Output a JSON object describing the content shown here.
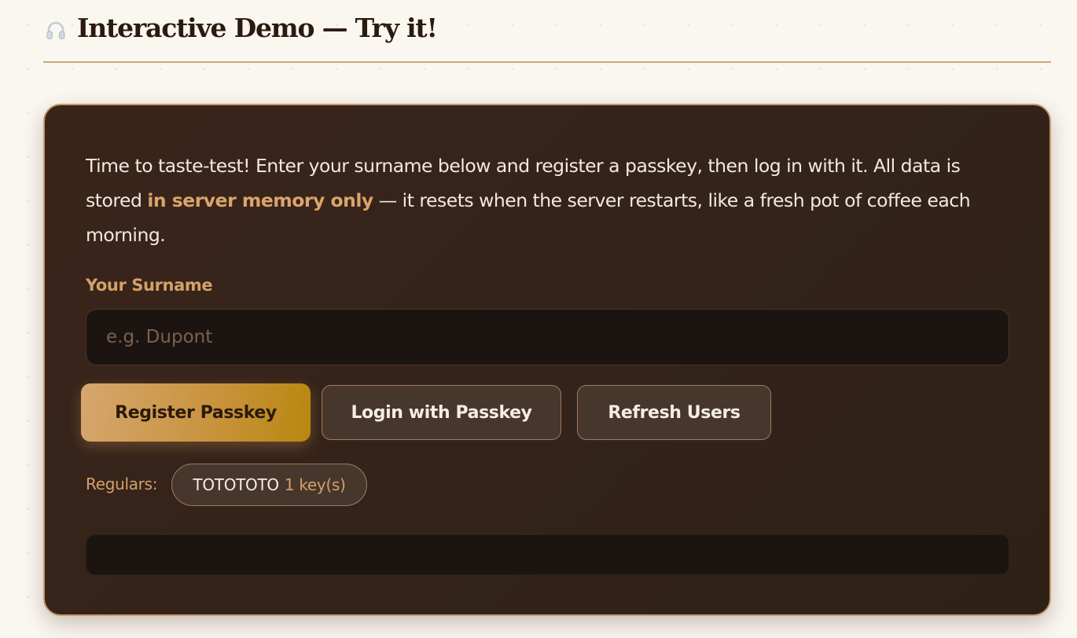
{
  "section": {
    "icon": "headphones-icon",
    "title": "Interactive Demo — Try it!"
  },
  "demo": {
    "intro_before": "Time to taste-test! Enter your surname below and register a passkey, then log in with it. All data is stored ",
    "intro_highlight": "in server memory only",
    "intro_after": " — it resets when the server restarts, like a fresh pot of coffee each morning.",
    "surname_label": "Your Surname",
    "surname_placeholder": "e.g. Dupont",
    "surname_value": "",
    "buttons": {
      "register": "Register Passkey",
      "login": "Login with Passkey",
      "refresh": "Refresh Users"
    },
    "regulars_label": "Regulars:",
    "users": [
      {
        "name": "TOTOTOTO",
        "keys": "1 key(s)"
      }
    ],
    "log_output": ""
  },
  "colors": {
    "page_background": "#faf6f0",
    "card_background": "#3a2419",
    "accent": "#d4a068",
    "primary_button_gradient_end": "#b8870e",
    "text_light": "#f3e9df",
    "heading": "#2a1a10"
  }
}
